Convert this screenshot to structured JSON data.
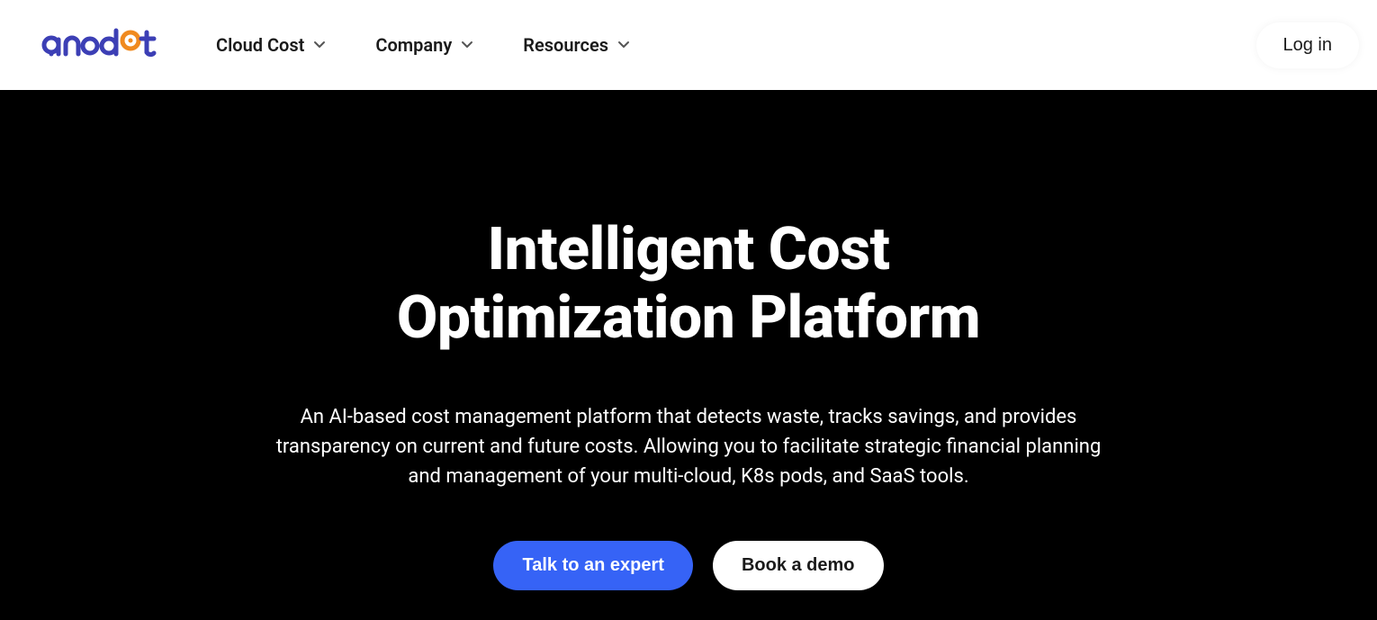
{
  "brand": {
    "name": "anodot"
  },
  "nav": {
    "items": [
      {
        "label": "Cloud Cost"
      },
      {
        "label": "Company"
      },
      {
        "label": "Resources"
      }
    ],
    "login": "Log in"
  },
  "hero": {
    "title_line1": "Intelligent Cost",
    "title_line2": "Optimization Platform",
    "subtitle": "An AI-based cost management platform that detects waste, tracks savings, and provides transparency on current and future costs. Allowing you to facilitate strategic financial planning and management of your multi-cloud, K8s pods, and SaaS tools.",
    "cta_primary": "Talk to an expert",
    "cta_secondary": "Book a demo"
  },
  "colors": {
    "brand_blue": "#3c3fb5",
    "brand_orange": "#f08a1f",
    "cta_blue": "#3663f6"
  }
}
